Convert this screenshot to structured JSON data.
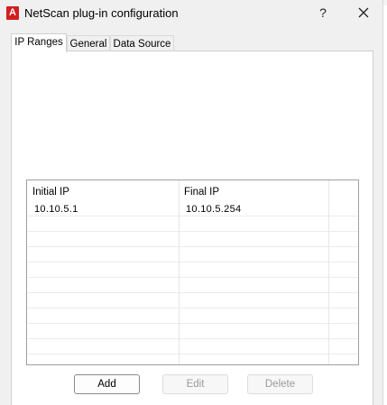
{
  "window": {
    "title": "NetScan plug-in configuration",
    "app_icon_letter": "A",
    "help_label": "?"
  },
  "tabs": [
    {
      "label": "IP Ranges",
      "active": true
    },
    {
      "label": "General",
      "active": false
    },
    {
      "label": "Data Source",
      "active": false
    }
  ],
  "table": {
    "columns": [
      "Initial IP",
      "Final IP"
    ],
    "rows": [
      {
        "initial_ip": "10.10.5.1",
        "final_ip": "10.10.5.254"
      }
    ]
  },
  "buttons": {
    "add": "Add",
    "edit": "Edit",
    "delete": "Delete"
  },
  "colors": {
    "app_icon": "#d21f1f",
    "window_bg": "#f0f0f0",
    "panel_bg": "#ffffff",
    "disabled_text": "#9a9a9a"
  }
}
